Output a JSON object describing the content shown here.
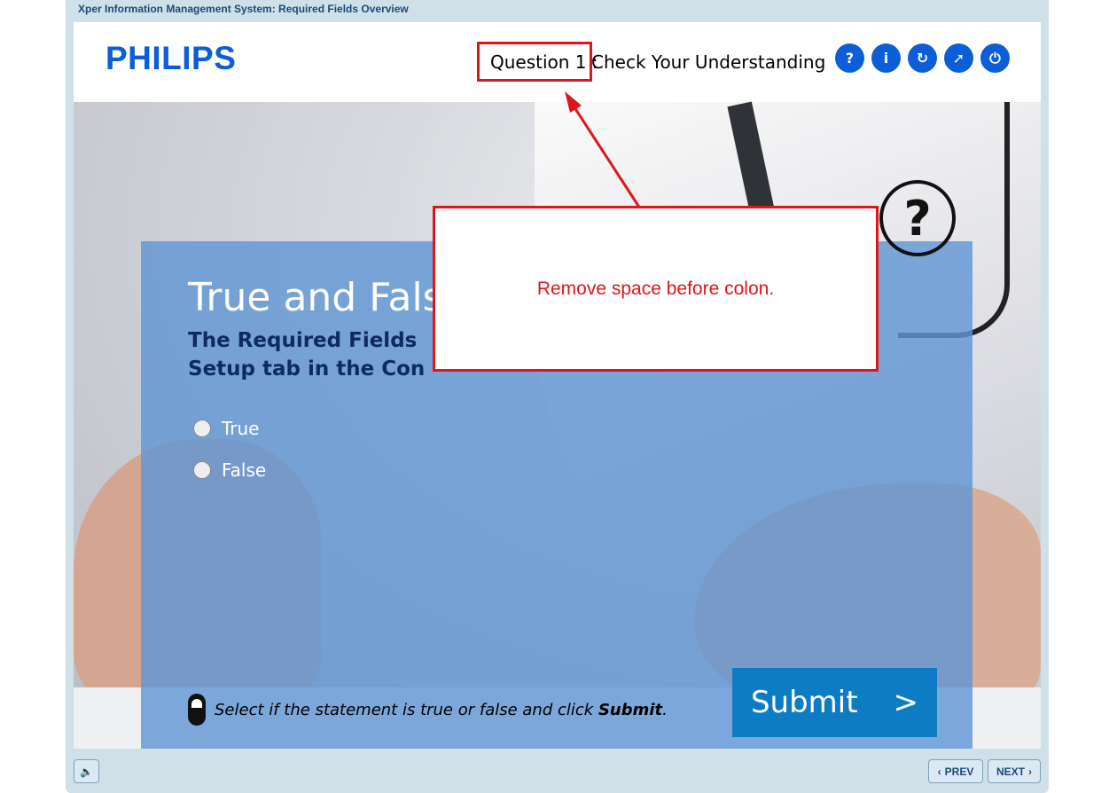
{
  "window": {
    "title": "Xper Information Management System: Required Fields Overview"
  },
  "header": {
    "logo": "PHILIPS",
    "question_number": "Question 1 :",
    "question_title": "Check Your Understanding",
    "icons": [
      {
        "name": "help-icon",
        "glyph": "?"
      },
      {
        "name": "info-icon",
        "glyph": "i"
      },
      {
        "name": "restart-icon",
        "glyph": "↻"
      },
      {
        "name": "navigate-icon",
        "glyph": "➚"
      },
      {
        "name": "exit-icon",
        "glyph": "⏻"
      }
    ]
  },
  "panel": {
    "title": "True and Fals",
    "statement_line1": "The Required Fields",
    "statement_line2": "Setup tab in the Con",
    "options": [
      "True",
      "False"
    ],
    "instruction_prefix": "Select if the statement is true or false and click ",
    "instruction_bold": "Submit",
    "instruction_suffix": ".",
    "submit_label": "Submit",
    "submit_arrow": ">"
  },
  "annotation": {
    "note": "Remove space before colon.",
    "color": "#e0151b"
  },
  "footer": {
    "audio_icon": "speaker-icon",
    "prev_label": "PREV",
    "next_label": "NEXT"
  },
  "colors": {
    "brand": "#0b5ed7",
    "panel": "#6296d4",
    "submit": "#0d7cc2"
  }
}
